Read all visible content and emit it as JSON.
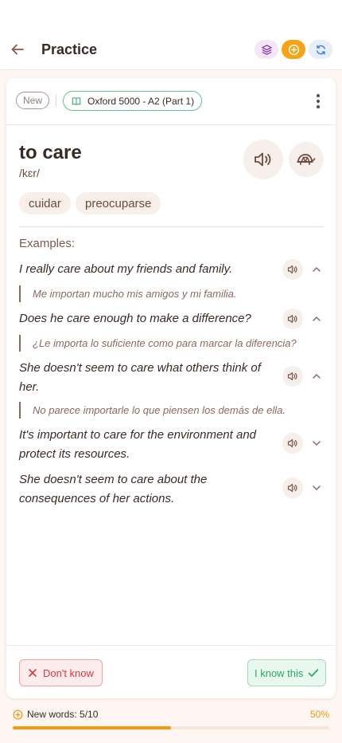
{
  "header": {
    "title": "Practice",
    "back_icon": "arrow-left-icon",
    "actions": [
      "layers-icon",
      "plus-circle-icon",
      "refresh-icon"
    ]
  },
  "card": {
    "status_badge": "New",
    "deck_name": "Oxford 5000 - A2 (Part 1)",
    "word": "to care",
    "phonetic": "/kɛr/",
    "translations": [
      "cuidar",
      "preocuparse"
    ],
    "examples_label": "Examples:",
    "examples": [
      {
        "text": "I really care about my friends and family.",
        "translation": "Me importan mucho mis amigos y mi familia.",
        "expanded": true
      },
      {
        "text": "Does he care enough to make a difference?",
        "translation": "¿Le importa lo suficiente como para marcar la diferencia?",
        "expanded": true
      },
      {
        "text": "She doesn't seem to care what others think of her.",
        "translation": "No parece importarle lo que piensen los demás de ella.",
        "expanded": true
      },
      {
        "text": "It's important to care for the environment and protect its resources.",
        "translation": "",
        "expanded": false
      },
      {
        "text": "She doesn't seem to care about the consequences of her actions.",
        "translation": "",
        "expanded": false
      }
    ],
    "dont_know_label": "Don't know",
    "know_label": "I know this"
  },
  "progress": {
    "label": "New words: 5/10",
    "percent_label": "50%",
    "fraction": 0.5
  },
  "colors": {
    "accent": "#f59a0c",
    "danger": "#d83a3a",
    "success": "#2aaa5e",
    "text": "#3a2a25"
  }
}
